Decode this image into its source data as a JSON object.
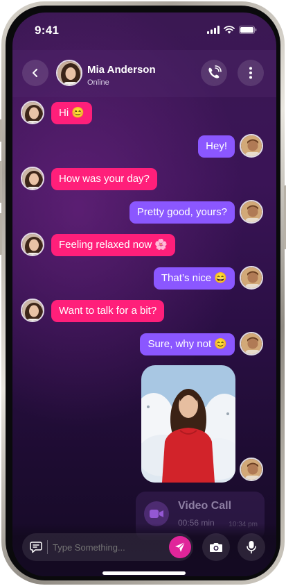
{
  "status_bar": {
    "time": "9:41"
  },
  "contact": {
    "name": "Mia Anderson",
    "status": "Online"
  },
  "messages": [
    {
      "from": "them",
      "text": "Hi 😊"
    },
    {
      "from": "me",
      "text": "Hey!"
    },
    {
      "from": "them",
      "text": "How was your day?"
    },
    {
      "from": "me",
      "text": "Pretty good, yours?"
    },
    {
      "from": "them",
      "text": "Feeling relaxed now 🌸"
    },
    {
      "from": "me",
      "text": "That’s nice 😄"
    },
    {
      "from": "them",
      "text": "Want to talk for a bit?"
    },
    {
      "from": "me",
      "text": "Sure, why not 😊"
    }
  ],
  "call": {
    "title": "Video Call",
    "duration": "00:56 min",
    "time": "10:34 pm"
  },
  "composer": {
    "placeholder": "Type Something..."
  },
  "colors": {
    "incoming": "#ff1f7a",
    "outgoing": "#8b57ff",
    "send": "#e0259a"
  },
  "icons": [
    "back-icon",
    "phone-call-icon",
    "more-vertical-icon",
    "message-icon",
    "send-icon",
    "camera-icon",
    "microphone-icon",
    "video-icon",
    "signal-icon",
    "wifi-icon",
    "battery-icon"
  ]
}
